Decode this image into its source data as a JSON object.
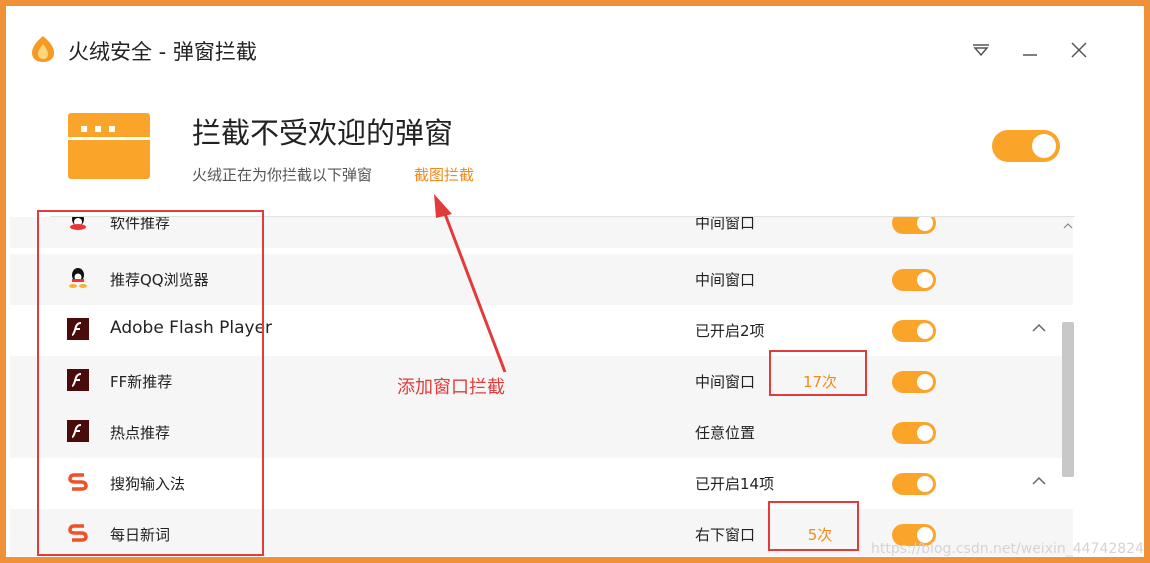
{
  "window": {
    "title": "火绒安全 - 弹窗拦截",
    "buttons": [
      "menu-icon",
      "minimize-icon",
      "close-icon"
    ]
  },
  "header": {
    "title": "拦截不受欢迎的弹窗",
    "subtitle": "火绒正在为你拦截以下弹窗",
    "link": "截图拦截",
    "toggle_on": true
  },
  "list": {
    "rows": [
      {
        "type": "child",
        "name": "软件推荐",
        "status": "中间窗口",
        "icon": "qq-icon",
        "toggle_on": true
      },
      {
        "type": "child",
        "name": "推荐QQ浏览器",
        "status": "中间窗口",
        "icon": "qq-icon",
        "toggle_on": true
      },
      {
        "type": "group",
        "name": "Adobe Flash Player",
        "status": "已开启2项",
        "icon": "flash-icon",
        "toggle_on": true
      },
      {
        "type": "child",
        "name": "FF新推荐",
        "status": "中间窗口",
        "count": "17次",
        "icon": "flash-icon",
        "toggle_on": true
      },
      {
        "type": "child",
        "name": "热点推荐",
        "status": "任意位置",
        "icon": "flash-icon",
        "toggle_on": true
      },
      {
        "type": "group",
        "name": "搜狗输入法",
        "status": "已开启14项",
        "icon": "sogou-icon",
        "toggle_on": true
      },
      {
        "type": "child",
        "name": "每日新词",
        "status": "右下窗口",
        "count": "5次",
        "icon": "sogou-icon",
        "toggle_on": true
      }
    ]
  },
  "annotation": {
    "label": "添加窗口拦截"
  },
  "watermark": "https://blog.csdn.net/weixin_44742824",
  "colors": {
    "accent": "#fba42a",
    "link": "#f08a1c",
    "annotation": "#e23b3b",
    "frame": "#f0913a"
  }
}
